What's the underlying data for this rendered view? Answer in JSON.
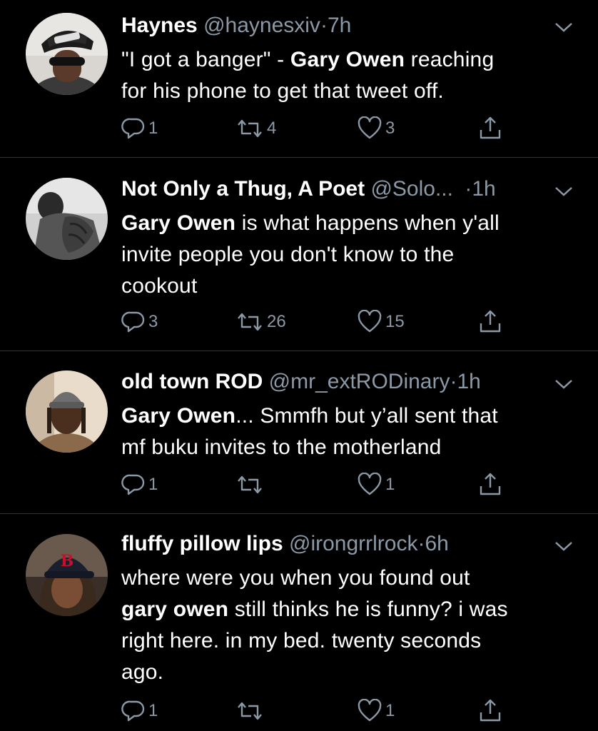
{
  "colors": {
    "background": "#000000",
    "text": "#ffffff",
    "secondary_text": "#8b98a5",
    "divider": "#2f3336"
  },
  "tweets": [
    {
      "name": "Haynes",
      "handle": "@haynesxiv",
      "separator": "·",
      "time": "7h",
      "text_before": "\"I got a banger\" - ",
      "text_bold": "Gary Owen",
      "text_after": " reaching\nfor his phone to get that tweet off.",
      "reply_count": "1",
      "retweet_count": "4",
      "like_count": "3",
      "avatar_icon": "avatar-new-york-cap"
    },
    {
      "name": "Not Only a Thug, A Poet",
      "handle": "@Solo...",
      "separator": "·",
      "time": "1h",
      "text_before": "",
      "text_bold": "Gary Owen",
      "text_after": " is what happens when y'all\ninvite people you don't know to the\ncookout",
      "reply_count": "3",
      "retweet_count": "26",
      "like_count": "15",
      "avatar_icon": "avatar-bw-tattoo"
    },
    {
      "name": "old town ROD",
      "handle": "@mr_extRODinary",
      "separator": "·",
      "time": "1h",
      "text_before": "",
      "text_bold": "Gary Owen",
      "text_after": "... Smmfh but y’all sent that\nmf buku invites to the motherland",
      "reply_count": "1",
      "retweet_count": "",
      "like_count": "1",
      "avatar_icon": "avatar-beanie"
    },
    {
      "name": "fluffy pillow lips",
      "handle": "@irongrrlrock",
      "separator": "·",
      "time": "6h",
      "text_before": "where were you when you found out\n",
      "text_bold": "gary owen",
      "text_after": " still thinks he is funny? i was\nright here. in my bed. twenty seconds\nago.",
      "reply_count": "1",
      "retweet_count": "",
      "like_count": "1",
      "avatar_icon": "avatar-red-sox-cap"
    }
  ],
  "icons": {
    "reply": "reply-icon",
    "retweet": "retweet-icon",
    "like": "heart-icon",
    "share": "share-icon",
    "more": "chevron-down-icon"
  }
}
